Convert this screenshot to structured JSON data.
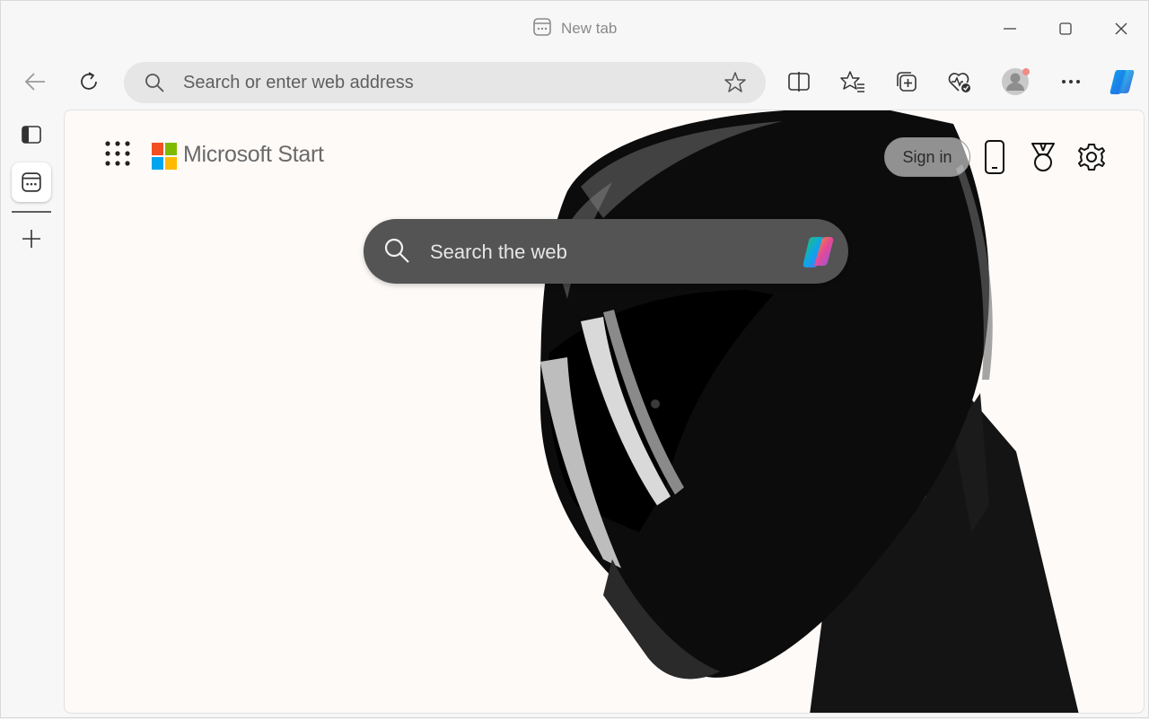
{
  "browser": {
    "tab": {
      "title": "New tab",
      "icon": "new-tab-icon"
    },
    "window_controls": [
      {
        "name": "minimize-button",
        "icon": "minimize-icon"
      },
      {
        "name": "maximize-button",
        "icon": "maximize-icon"
      },
      {
        "name": "close-button",
        "icon": "close-icon"
      }
    ],
    "toolbar": {
      "back_icon": "back-arrow-icon",
      "refresh_icon": "refresh-icon",
      "address_placeholder": "Search or enter web address",
      "favorite_icon": "star-icon",
      "actions": [
        "split-screen-icon",
        "favorites-icon",
        "collections-icon",
        "browser-essentials-icon",
        "profile-avatar",
        "more-icon",
        "copilot-icon"
      ]
    },
    "vertical_tabs": [
      {
        "icon": "tab-actions-icon",
        "active": false
      },
      {
        "icon": "new-tab-icon",
        "active": true
      },
      {
        "icon": "plus-icon",
        "active": false
      }
    ]
  },
  "page": {
    "brand": "Microsoft Start",
    "apps_icon": "app-launcher-icon",
    "sign_in_label": "Sign in",
    "header_icons": [
      "mobile-phone-icon",
      "rewards-medal-icon",
      "settings-gear-icon"
    ],
    "search": {
      "placeholder": "Search the web",
      "icon": "search-icon",
      "assistant_icon": "copilot-icon"
    }
  },
  "colors": {
    "chrome_bg": "#f7f7f7",
    "address_bg": "#e6e6e6",
    "page_bg": "#fdfaf8",
    "search_bg": "#545454",
    "ms_red": "#f25022",
    "ms_green": "#7fba00",
    "ms_blue": "#00a4ef",
    "ms_yellow": "#ffb900",
    "profile_badge": "#f28b82"
  }
}
